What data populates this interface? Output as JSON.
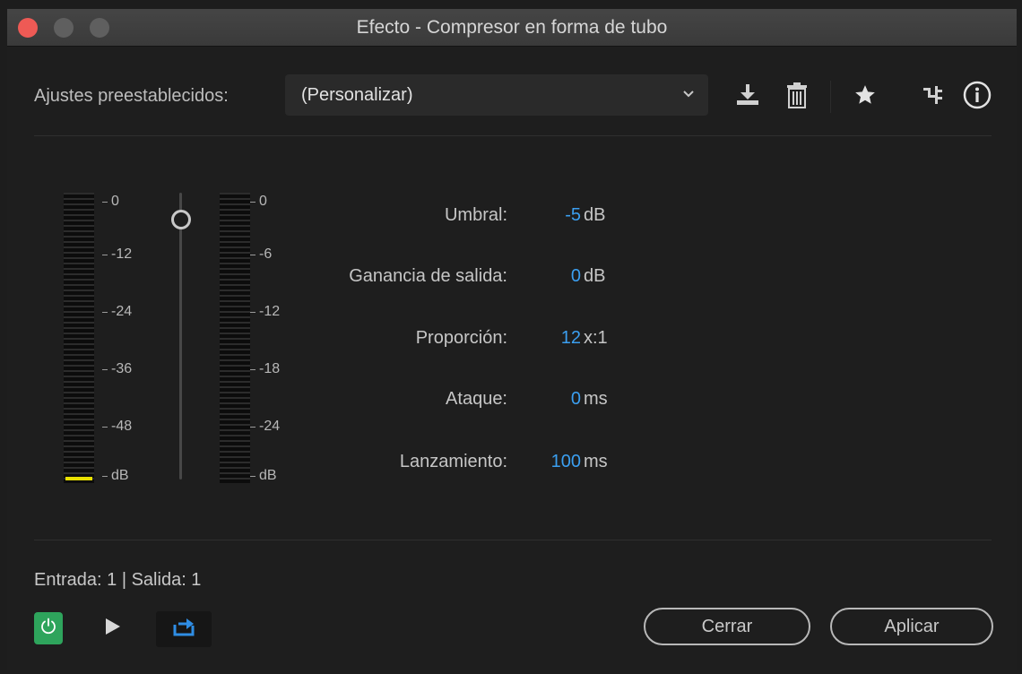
{
  "window": {
    "title": "Efecto - Compresor en forma de tubo"
  },
  "presets": {
    "label": "Ajustes preestablecidos:",
    "selected": "(Personalizar)"
  },
  "toolbar": {
    "icons": [
      "download-preset-icon",
      "trash-icon",
      "star-icon",
      "routing-icon",
      "info-icon"
    ]
  },
  "meters": {
    "input": {
      "ticks": [
        "0",
        "-12",
        "-24",
        "-36",
        "-48",
        "dB"
      ],
      "level_fraction": 0.01,
      "level_color": "#e8e000"
    },
    "output": {
      "ticks": [
        "0",
        "-6",
        "-12",
        "-18",
        "-24",
        "dB"
      ]
    },
    "slider": {
      "value_fraction": 0.9
    }
  },
  "params": [
    {
      "label": "Umbral:",
      "value": "-5",
      "unit": "dB"
    },
    {
      "label": "Ganancia de salida:",
      "value": "0",
      "unit": "dB"
    },
    {
      "label": "Proporción:",
      "value": "12",
      "unit": "x:1"
    },
    {
      "label": "Ataque:",
      "value": "0",
      "unit": "ms"
    },
    {
      "label": "Lanzamiento:",
      "value": "100",
      "unit": "ms"
    }
  ],
  "footer": {
    "io_text": "Entrada: 1 | Salida: 1",
    "close_label": "Cerrar",
    "apply_label": "Aplicar"
  },
  "colors": {
    "accent": "#3b9ff0",
    "power": "#2ea45c",
    "close_dot": "#ee5a55"
  }
}
